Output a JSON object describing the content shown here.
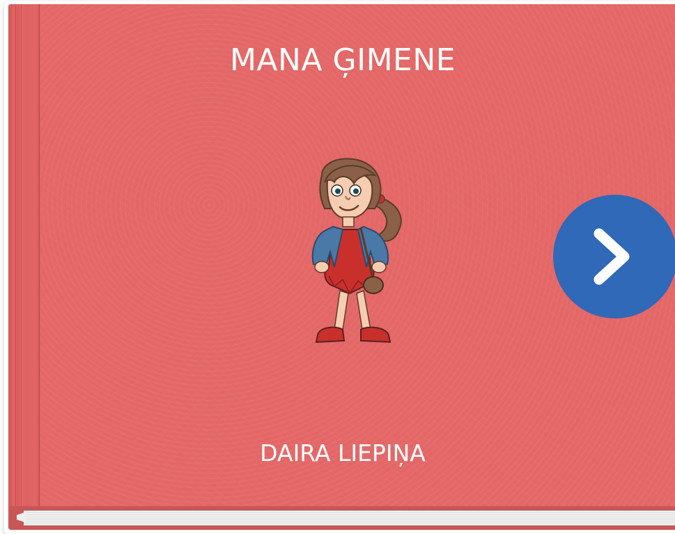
{
  "book": {
    "title": "MANA ĢIMENE",
    "author": "DAIRA LIEPIŅA",
    "cover_color": "#e46767",
    "illustration": "girl-character-illustration"
  },
  "navigation": {
    "next_icon": "chevron-right-icon",
    "button_color": "#2f69b7"
  }
}
